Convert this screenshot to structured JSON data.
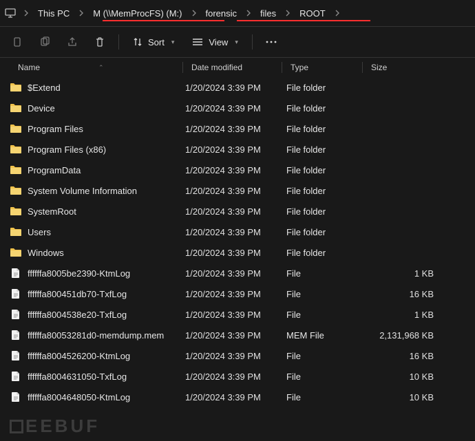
{
  "breadcrumb": [
    {
      "label": "This PC"
    },
    {
      "label": "M (\\\\MemProcFS) (M:)"
    },
    {
      "label": "forensic"
    },
    {
      "label": "files"
    },
    {
      "label": "ROOT"
    }
  ],
  "toolbar": {
    "sort_label": "Sort",
    "view_label": "View"
  },
  "columns": {
    "name": "Name",
    "date": "Date modified",
    "type": "Type",
    "size": "Size"
  },
  "rows": [
    {
      "icon": "folder",
      "name": "$Extend",
      "date": "1/20/2024 3:39 PM",
      "type": "File folder",
      "size": ""
    },
    {
      "icon": "folder",
      "name": "Device",
      "date": "1/20/2024 3:39 PM",
      "type": "File folder",
      "size": ""
    },
    {
      "icon": "folder",
      "name": "Program Files",
      "date": "1/20/2024 3:39 PM",
      "type": "File folder",
      "size": ""
    },
    {
      "icon": "folder",
      "name": "Program Files (x86)",
      "date": "1/20/2024 3:39 PM",
      "type": "File folder",
      "size": ""
    },
    {
      "icon": "folder",
      "name": "ProgramData",
      "date": "1/20/2024 3:39 PM",
      "type": "File folder",
      "size": ""
    },
    {
      "icon": "folder",
      "name": "System Volume Information",
      "date": "1/20/2024 3:39 PM",
      "type": "File folder",
      "size": ""
    },
    {
      "icon": "folder",
      "name": "SystemRoot",
      "date": "1/20/2024 3:39 PM",
      "type": "File folder",
      "size": ""
    },
    {
      "icon": "folder",
      "name": "Users",
      "date": "1/20/2024 3:39 PM",
      "type": "File folder",
      "size": ""
    },
    {
      "icon": "folder",
      "name": "Windows",
      "date": "1/20/2024 3:39 PM",
      "type": "File folder",
      "size": ""
    },
    {
      "icon": "file",
      "name": "ffffffa8005be2390-KtmLog",
      "date": "1/20/2024 3:39 PM",
      "type": "File",
      "size": "1 KB"
    },
    {
      "icon": "file",
      "name": "ffffffa800451db70-TxfLog",
      "date": "1/20/2024 3:39 PM",
      "type": "File",
      "size": "16 KB"
    },
    {
      "icon": "file",
      "name": "ffffffa8004538e20-TxfLog",
      "date": "1/20/2024 3:39 PM",
      "type": "File",
      "size": "1 KB"
    },
    {
      "icon": "file",
      "name": "ffffffa80053281d0-memdump.mem",
      "date": "1/20/2024 3:39 PM",
      "type": "MEM File",
      "size": "2,131,968 KB"
    },
    {
      "icon": "file",
      "name": "ffffffa8004526200-KtmLog",
      "date": "1/20/2024 3:39 PM",
      "type": "File",
      "size": "16 KB"
    },
    {
      "icon": "file",
      "name": "ffffffa8004631050-TxfLog",
      "date": "1/20/2024 3:39 PM",
      "type": "File",
      "size": "10 KB"
    },
    {
      "icon": "file",
      "name": "ffffffa8004648050-KtmLog",
      "date": "1/20/2024 3:39 PM",
      "type": "File",
      "size": "10 KB"
    }
  ],
  "watermark": "EEBUF"
}
